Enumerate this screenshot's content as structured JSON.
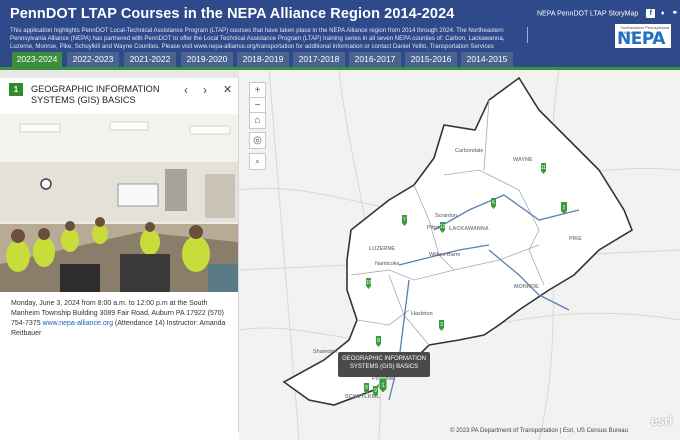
{
  "header": {
    "title": "PennDOT LTAP Courses in the NEPA Alliance Region 2014-2024",
    "description": "This application highlights PennDOT Local-Technical Assistance Program (LTAP) courses that have taken place in the NEPA Alliance region from 2014 through 2024. The Northeastern Pennsylvania Alliance (NEPA) has partnered with PennDOT to offer the Local Technical Assistance Program (LTAP) training series in all seven NEPA counties of: Carbon, Lackawanna, Luzerne, Monroe, Pike, Schuylkill and Wayne Counties. Please visit www.nepa-alliance.org/transportation for additional information or contact Daniel Yelito, Transportation Services",
    "storymap_label": "NEPA PennDOT LTAP StoryMap",
    "share_icons": [
      "facebook-icon",
      "twitter-icon",
      "link-icon"
    ],
    "logo_text": "NEPA",
    "logo_tagline": "Northeastern Pennsylvania Alliance"
  },
  "tabs": [
    {
      "label": "2023-2024",
      "active": true
    },
    {
      "label": "2022-2023",
      "active": false
    },
    {
      "label": "2021-2022",
      "active": false
    },
    {
      "label": "2019-2020",
      "active": false
    },
    {
      "label": "2018-2019",
      "active": false
    },
    {
      "label": "2017-2018",
      "active": false
    },
    {
      "label": "2016-2017",
      "active": false
    },
    {
      "label": "2015-2016",
      "active": false
    },
    {
      "label": "2014-2015",
      "active": false
    }
  ],
  "panel": {
    "number": "1",
    "title": "GEOGRAPHIC INFORMATION SYSTEMS (GIS) BASICS",
    "prev_icon": "‹",
    "next_icon": "›",
    "close_icon": "✕",
    "body_text": "Monday, June 3, 2024 from 8:00 a.m. to 12:00 p.m at  the South Manheim Township Building 3089 Fair Road, Auburn PA 17922 (570) 754-7375 ",
    "link_text": "www.nepa-alliance.org",
    "body_tail": " (Attendance 14) Instructor: Amanda Reitbauer"
  },
  "map": {
    "controls": [
      "+",
      "−",
      "⌂",
      "◎",
      "🔍"
    ],
    "place_labels": [
      "Carbondale",
      "Scranton",
      "Pittston",
      "LACKAWANNA",
      "WAYNE",
      "PIKE",
      "LUZERNE",
      "Nanticoke",
      "Wilkes-Barre",
      "Hazleton",
      "MONROE",
      "Pottsville",
      "SCHUYLKILL",
      "Shamokin"
    ],
    "tooltip": "GEOGRAPHIC INFORMATION SYSTEMS (GIS) BASICS",
    "markers": [
      "11",
      "2",
      "6",
      "12",
      "7",
      "10",
      "8",
      "3",
      "8",
      "9",
      "1"
    ],
    "attribution": "© 2023 PA Department of Transportation | Esri, US Census Bureau",
    "esri_label": "esri",
    "colors": {
      "region": "#ffffff",
      "outline": "#333333",
      "marker": "#3b9a3b",
      "accent": "#3b8f3a",
      "header": "#2f4a8a"
    }
  }
}
